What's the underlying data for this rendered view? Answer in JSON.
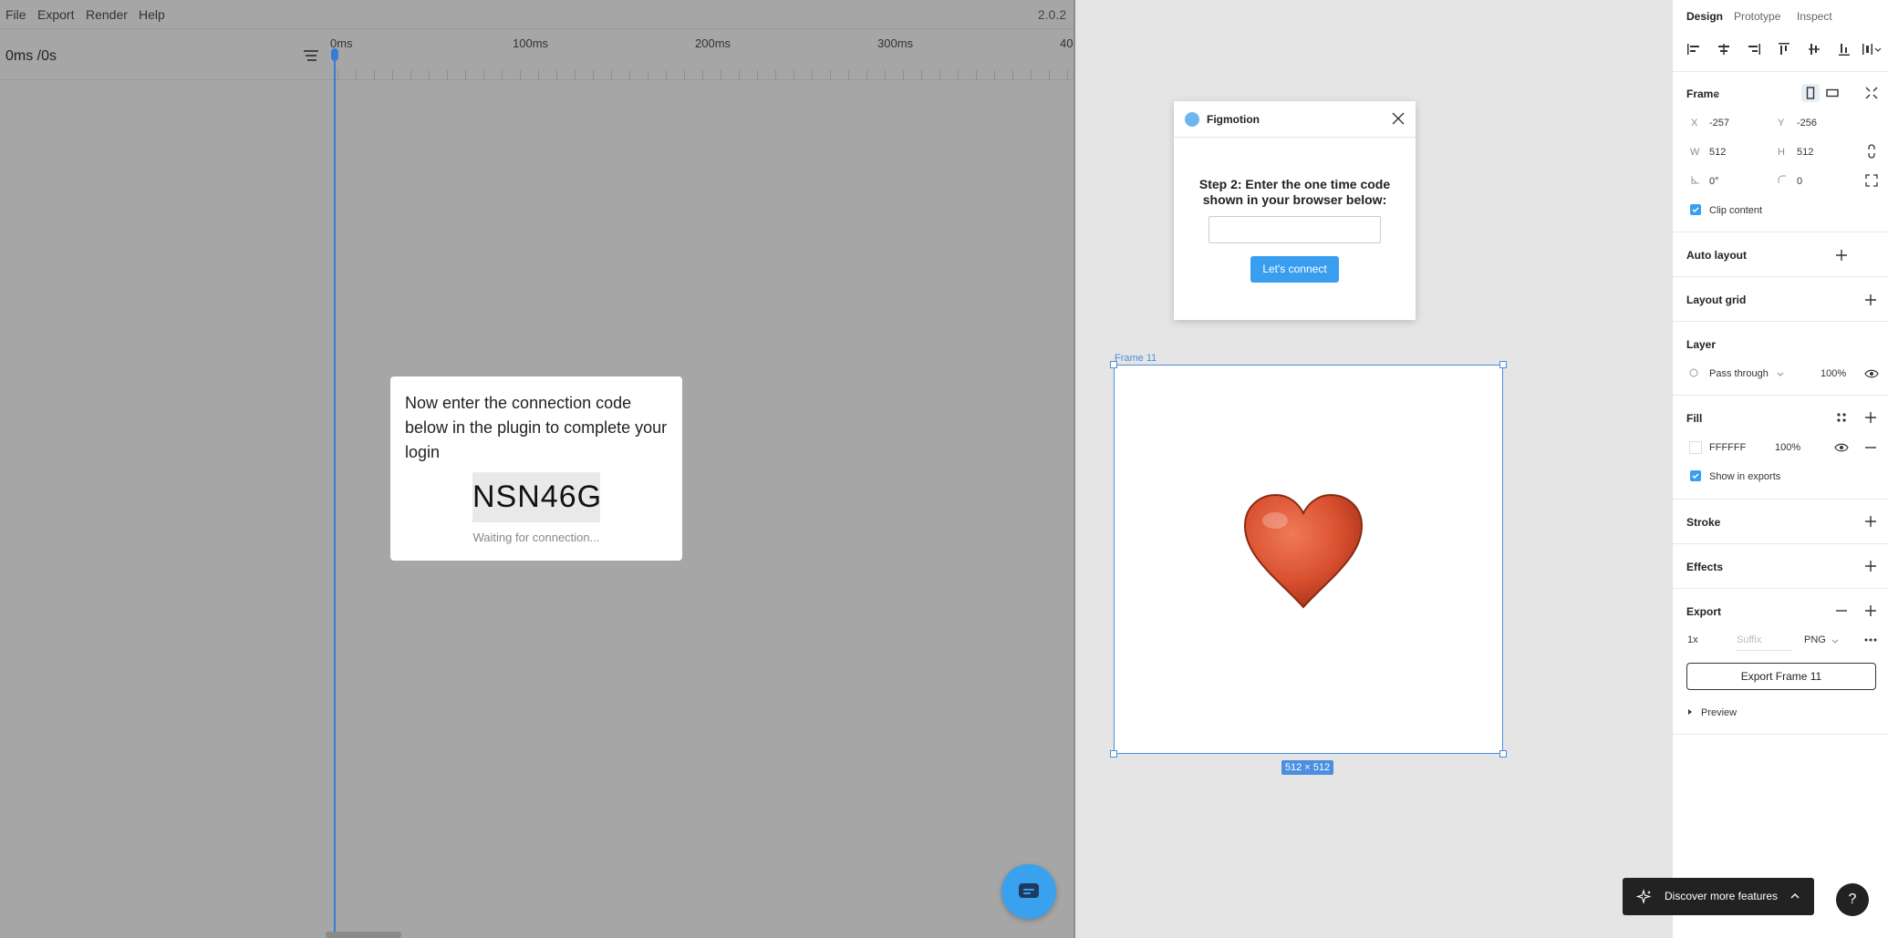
{
  "figmotion": {
    "menu": [
      "File",
      "Export",
      "Render",
      "Help"
    ],
    "version": "2.0.2",
    "time_display": "0ms /0s",
    "ruler": [
      "0ms",
      "100ms",
      "200ms",
      "300ms",
      "40"
    ],
    "connection": {
      "message": "Now enter the connection code below in the plugin to complete your login",
      "code": "NSN46G",
      "status": "Waiting for connection..."
    }
  },
  "plugin": {
    "title": "Figmotion",
    "step": "Step 2: Enter the one time code shown in your browser below:",
    "input_value": "",
    "button": "Let's connect"
  },
  "canvas": {
    "frame_name": "Frame 11",
    "frame_size": "512 × 512",
    "emoji": "❤️"
  },
  "props": {
    "tabs": [
      "Design",
      "Prototype",
      "Inspect"
    ],
    "frame": {
      "title": "Frame",
      "x_label": "X",
      "x": "-257",
      "y_label": "Y",
      "y": "-256",
      "w_label": "W",
      "w": "512",
      "h_label": "H",
      "h": "512",
      "rotation": "0°",
      "radius": "0",
      "clip_content": "Clip content"
    },
    "auto_layout": "Auto layout",
    "layout_grid": "Layout grid",
    "layer": {
      "title": "Layer",
      "blend": "Pass through",
      "opacity": "100%"
    },
    "fill": {
      "title": "Fill",
      "color": "FFFFFF",
      "opacity": "100%",
      "show_exports": "Show in exports"
    },
    "stroke": "Stroke",
    "effects": "Effects",
    "export": {
      "title": "Export",
      "scale": "1x",
      "suffix_placeholder": "Suffix",
      "format": "PNG",
      "button": "Export Frame 11",
      "preview": "Preview"
    }
  },
  "discover": "Discover more features",
  "help": "?",
  "colors": {
    "accent": "#3a9ef0",
    "selection": "#4a8fe0",
    "panel_bg": "#a6a6a6"
  }
}
